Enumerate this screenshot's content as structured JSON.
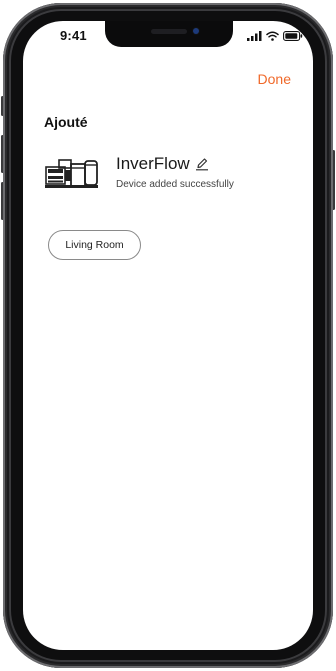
{
  "status_bar": {
    "time": "9:41",
    "icons": [
      "signal-icon",
      "wifi-icon",
      "battery-icon"
    ]
  },
  "header": {
    "done_label": "Done"
  },
  "section": {
    "title": "Ajouté"
  },
  "device": {
    "name": "InverFlow",
    "status": "Device added successfully",
    "icon": "pump-device-icon",
    "edit_icon": "pencil-edit-icon"
  },
  "rooms": [
    {
      "label": "Living Room"
    }
  ],
  "colors": {
    "accent": "#f0692a",
    "text": "#1a1a1a",
    "pill_border": "#8a8a8a"
  }
}
